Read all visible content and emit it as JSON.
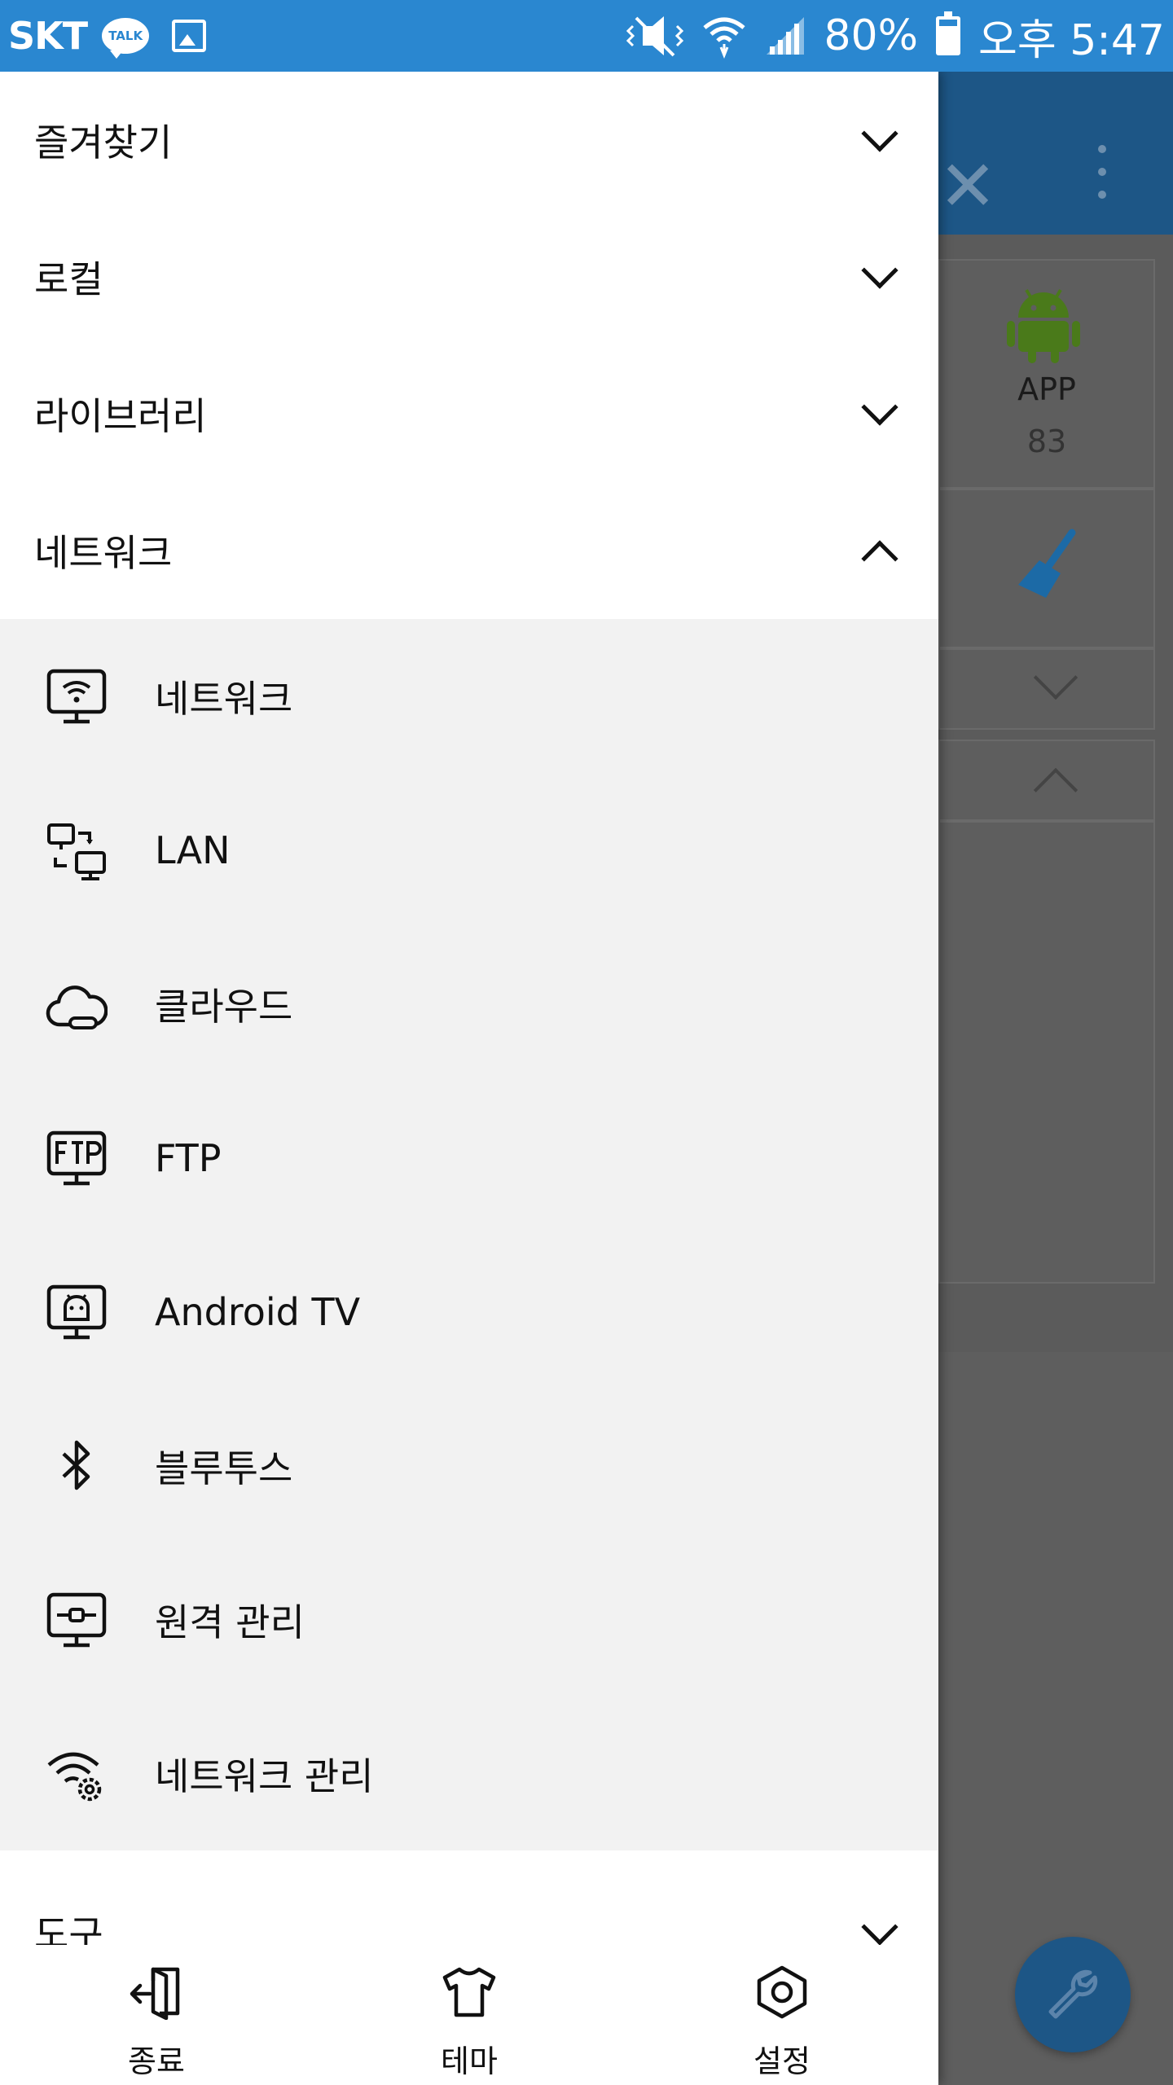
{
  "status_bar": {
    "carrier": "SKT",
    "talk_badge": "TALK",
    "battery": "80%",
    "battery_level": 0.8,
    "time": "오후 5:47"
  },
  "background": {
    "app_label": "APP",
    "app_count": "83"
  },
  "drawer": {
    "sections": [
      {
        "label": "즐겨찾기",
        "expanded": false
      },
      {
        "label": "로컬",
        "expanded": false
      },
      {
        "label": "라이브러리",
        "expanded": false
      },
      {
        "label": "네트워크",
        "expanded": true
      },
      {
        "label": "도구",
        "expanded": false
      }
    ],
    "network_items": [
      {
        "label": "네트워크",
        "icon": "network-monitor-icon"
      },
      {
        "label": "LAN",
        "icon": "lan-icon"
      },
      {
        "label": "클라우드",
        "icon": "cloud-icon"
      },
      {
        "label": "FTP",
        "icon": "ftp-icon"
      },
      {
        "label": "Android TV",
        "icon": "android-tv-icon"
      },
      {
        "label": "블루투스",
        "icon": "bluetooth-icon"
      },
      {
        "label": "원격 관리",
        "icon": "remote-manage-icon"
      },
      {
        "label": "네트워크 관리",
        "icon": "network-manage-icon"
      }
    ],
    "bottom": {
      "exit": "종료",
      "theme": "테마",
      "settings": "설정"
    }
  },
  "colors": {
    "status_bar": "#2a87d0",
    "toolbar_dimmed": "#1d5686",
    "android_green_dimmed": "#4a7a1a",
    "cleaner_blue_dimmed": "#1c6aa6"
  }
}
